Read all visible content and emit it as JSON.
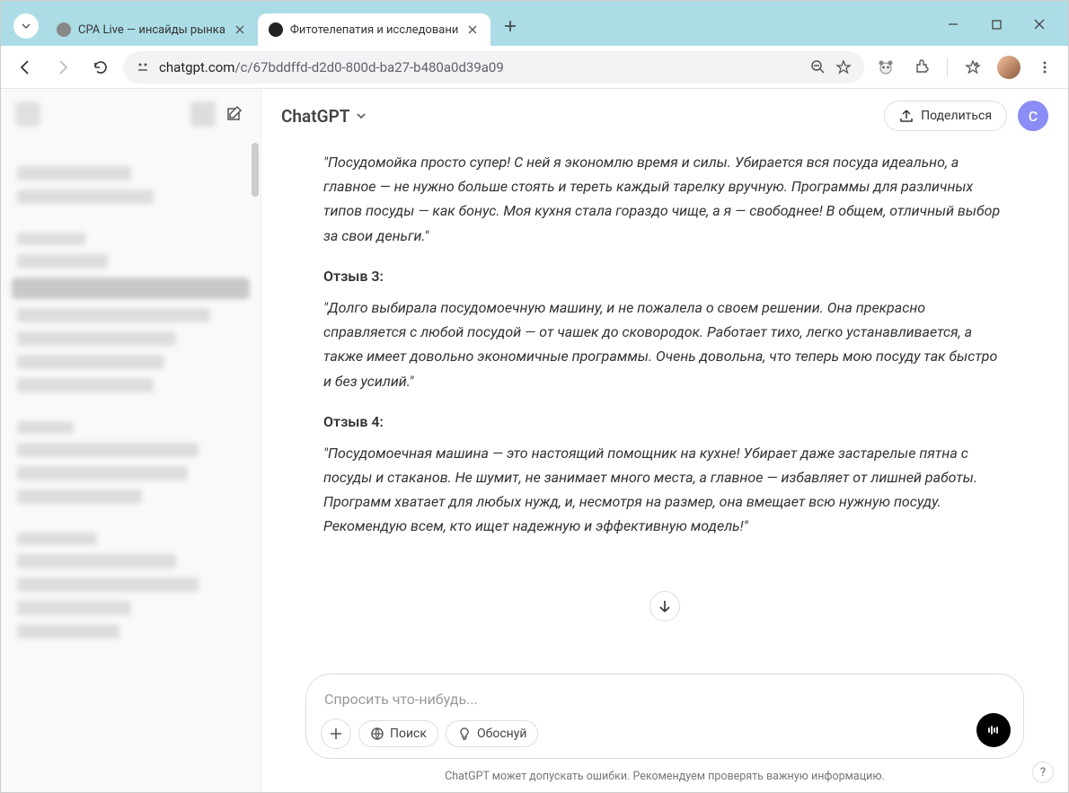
{
  "window": {
    "tabs": [
      {
        "title": "CPA Live — инсайды рынка",
        "active": false
      },
      {
        "title": "Фитотелепатия и исследовани",
        "active": true
      }
    ],
    "url_host": "chatgpt.com",
    "url_path": "/c/67bddffd-d2d0-800d-ba27-b480a0d39a09"
  },
  "header": {
    "brand": "ChatGPT",
    "share": "Поделиться",
    "user_initial": "С"
  },
  "chat": {
    "p1": "\"Посудомойка просто супер! С ней я экономлю время и силы. Убирается вся посуда идеально, а главное — не нужно больше стоять и тереть каждый тарелку вручную. Программы для различных типов посуды — как бонус. Моя кухня стала гораздо чище, а я — свободнее! В общем, отличный выбор за свои деньги.\"",
    "h3": "Отзыв 3:",
    "p3": "\"Долго выбирала посудомоечную машину, и не пожалела о своем решении. Она прекрасно справляется с любой посудой — от чашек до сковородок. Работает тихо, легко устанавливается, а также имеет довольно экономичные программы. Очень довольна, что теперь мою посуду так быстро и без усилий.\"",
    "h4": "Отзыв 4:",
    "p4": "\"Посудомоечная машина — это настоящий помощник на кухне! Убирает даже застарелые пятна с посуды и стаканов. Не шумит, не занимает много места, а главное — избавляет от лишней работы. Программ хватает для любых нужд, и, несмотря на размер, она вмещает всю нужную посуду. Рекомендую всем, кто ищет надежную и эффективную модель!\""
  },
  "input": {
    "placeholder": "Спросить что-нибудь...",
    "search_label": "Поиск",
    "reason_label": "Обоснуй"
  },
  "footer": {
    "note": "ChatGPT может допускать ошибки. Рекомендуем проверять важную информацию.",
    "help": "?"
  }
}
